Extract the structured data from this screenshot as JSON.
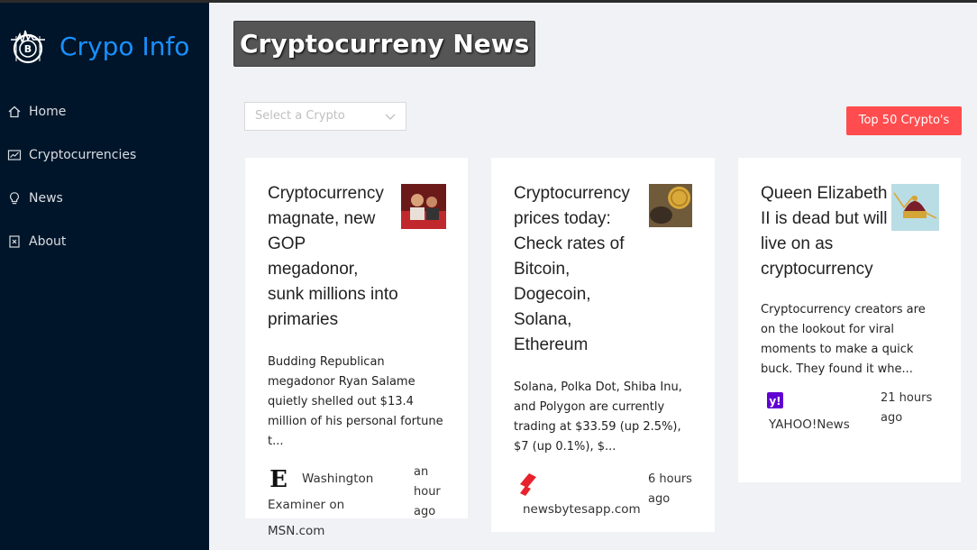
{
  "app": {
    "title": "Crypo Info"
  },
  "sidebar": {
    "items": [
      {
        "label": "Home",
        "icon": "home-icon"
      },
      {
        "label": "Cryptocurrencies",
        "icon": "fund-icon"
      },
      {
        "label": "News",
        "icon": "bulb-icon"
      },
      {
        "label": "About",
        "icon": "about-icon"
      }
    ]
  },
  "page": {
    "title": "Cryptocurreny News",
    "select_placeholder": "Select a Crypto",
    "top_button": "Top 50 Crypto's"
  },
  "colors": {
    "sidebar": "#001529",
    "accent": "#1890ff",
    "danger": "#ff4d4f"
  },
  "news": [
    {
      "title": "Cryptocurrency magnate, new GOP megadonor, sunk millions into primaries",
      "description": "Budding Republican megadonor Ryan Salame quietly shelled out $13.4 million of his personal fortune t...",
      "provider": "Washington Examiner on MSN.com",
      "time": "an hour ago"
    },
    {
      "title": "Cryptocurrency prices today: Check rates of Bitcoin, Dogecoin, Solana, Ethereum",
      "description": "Solana, Polka Dot, Shiba Inu, and Polygon are currently trading at $33.59 (up 2.5%), $7 (up 0.1%), $...",
      "provider": "newsbytesapp.com",
      "time": "6 hours ago"
    },
    {
      "title": "Queen Elizabeth II is dead but will live on as cryptocurrency",
      "description": "Cryptocurrency creators are on the lookout for viral moments to make a quick buck. They found it whe...",
      "provider": "YAHOO!News",
      "time": "21 hours ago"
    }
  ]
}
